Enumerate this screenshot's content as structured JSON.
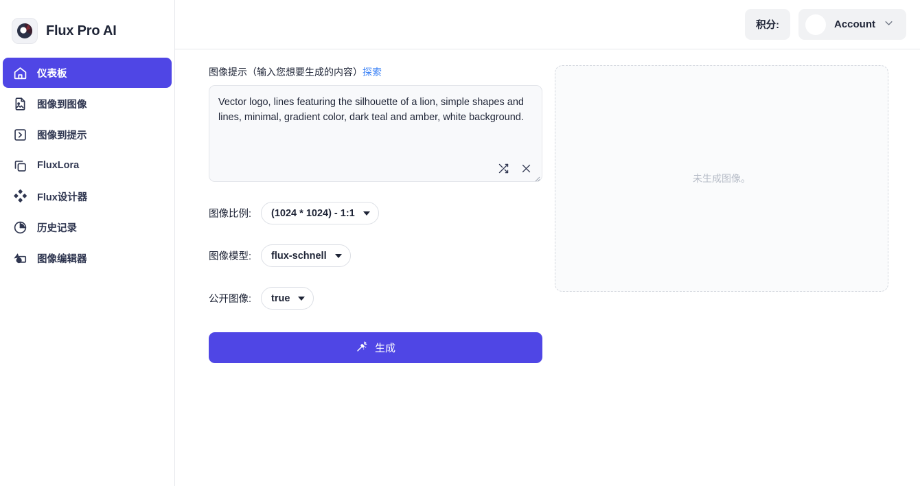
{
  "brand": {
    "title": "Flux Pro AI",
    "logo_icon": "flux-orb-logo"
  },
  "sidebar": {
    "items": [
      {
        "label": "仪表板",
        "icon": "home-icon",
        "active": true
      },
      {
        "label": "图像到图像",
        "icon": "image-file-icon",
        "active": false
      },
      {
        "label": "图像到提示",
        "icon": "chevron-box-icon",
        "active": false
      },
      {
        "label": "FluxLora",
        "icon": "copy-icon",
        "active": false
      },
      {
        "label": "Flux设计器",
        "icon": "diamond-grid-icon",
        "active": false
      },
      {
        "label": "历史记录",
        "icon": "pie-chart-icon",
        "active": false
      },
      {
        "label": "图像编辑器",
        "icon": "image-editor-icon",
        "active": false
      }
    ]
  },
  "topbar": {
    "credits_label": "积分:",
    "account_label": "Account",
    "chevron_icon": "chevron-down-icon",
    "avatar_icon": "avatar"
  },
  "prompt": {
    "label_main": "图像提示（输入您想要生成的内容）",
    "label_link": "探索",
    "value": "Vector logo, lines featuring the silhouette of a lion, simple shapes and lines, minimal, gradient color, dark teal and amber, white background.",
    "placeholder": "",
    "shuffle_icon": "shuffle-icon",
    "clear_icon": "close-icon"
  },
  "fields": {
    "ratio": {
      "label": "图像比例:",
      "value": "(1024 * 1024) - 1:1"
    },
    "model": {
      "label": "图像模型:",
      "value": "flux-schnell"
    },
    "public": {
      "label": "公开图像:",
      "value": "true"
    }
  },
  "generate": {
    "label": "生成",
    "icon": "magic-wand-icon"
  },
  "preview": {
    "empty_text": "未生成图像。"
  },
  "colors": {
    "accent": "#4f46e5",
    "link": "#3b82f6",
    "text": "#1e2436",
    "muted": "#b6bcc7",
    "border": "#e5e7eb"
  }
}
